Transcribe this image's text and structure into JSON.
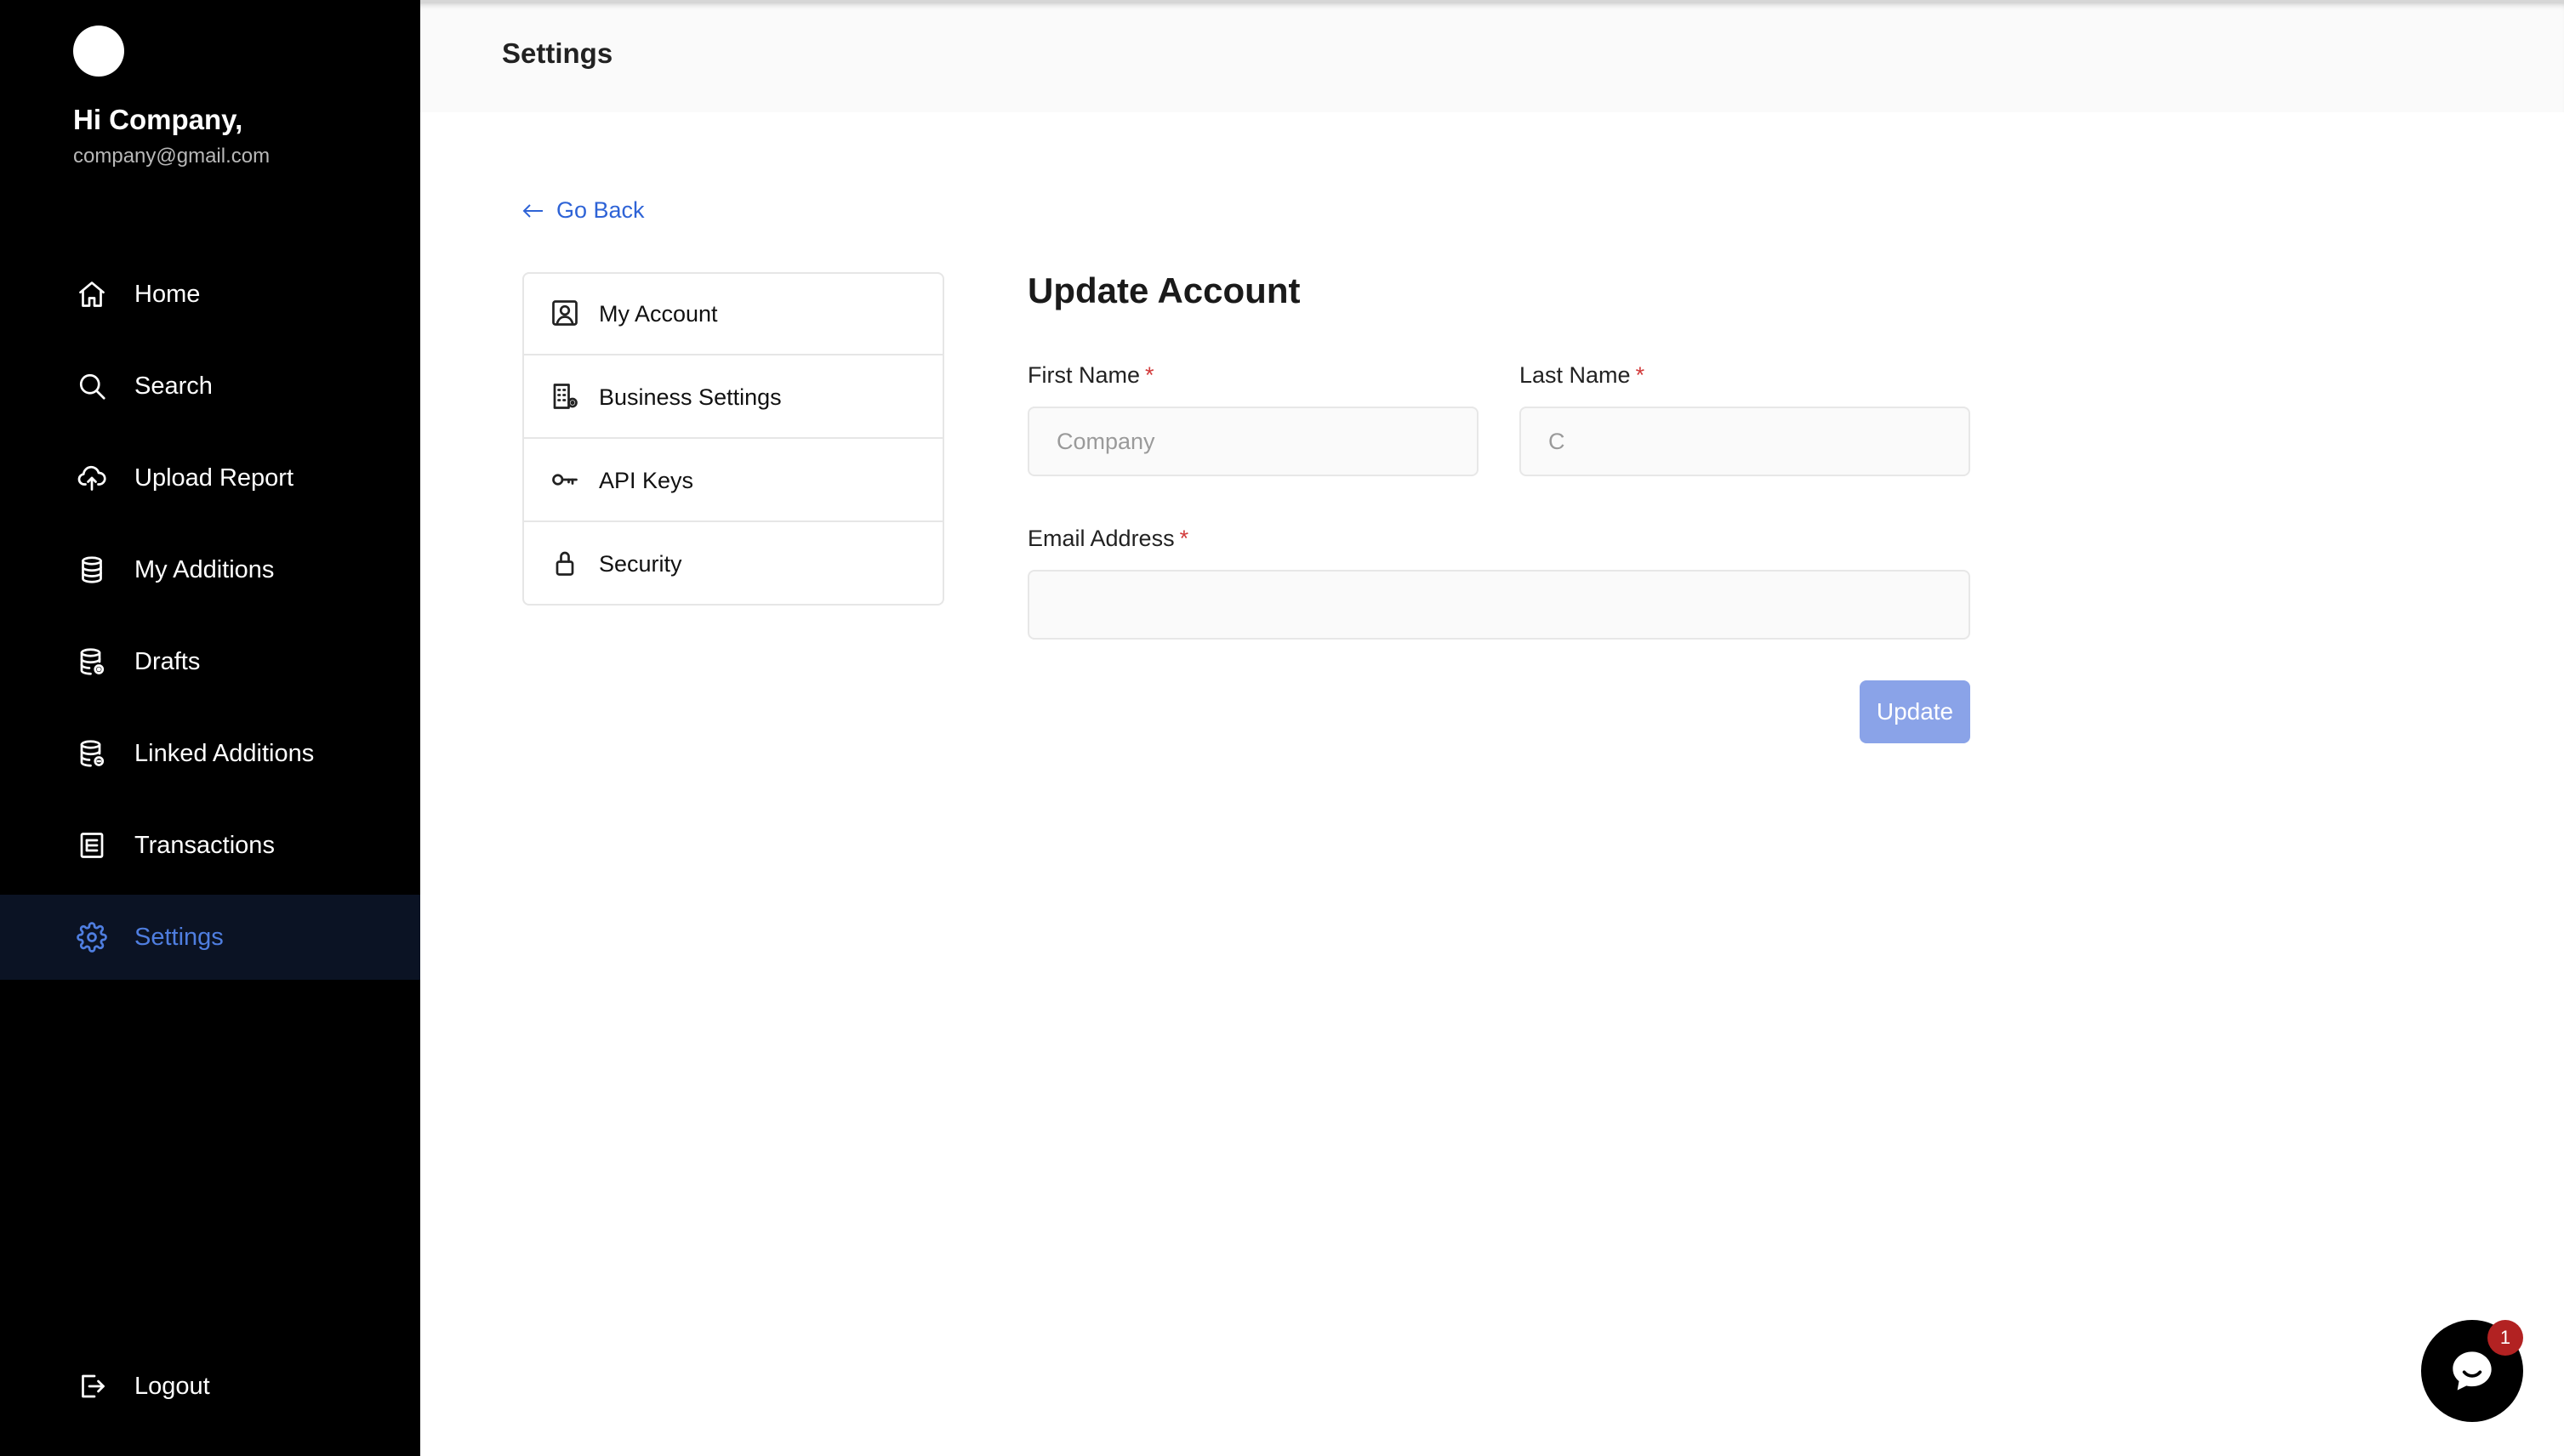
{
  "sidebar": {
    "greeting": "Hi Company,",
    "email": "company@gmail.com",
    "items": [
      {
        "label": "Home",
        "icon": "home-icon"
      },
      {
        "label": "Search",
        "icon": "search-icon"
      },
      {
        "label": "Upload Report",
        "icon": "cloud-upload-icon"
      },
      {
        "label": "My Additions",
        "icon": "database-icon"
      },
      {
        "label": "Drafts",
        "icon": "database-settings-icon"
      },
      {
        "label": "Linked Additions",
        "icon": "database-link-icon"
      },
      {
        "label": "Transactions",
        "icon": "receipt-icon"
      },
      {
        "label": "Settings",
        "icon": "gear-icon",
        "active": true
      }
    ],
    "logout": "Logout"
  },
  "header": {
    "title": "Settings"
  },
  "go_back": "Go Back",
  "settings_menu": [
    {
      "label": "My Account",
      "icon": "user-square-icon"
    },
    {
      "label": "Business Settings",
      "icon": "building-icon"
    },
    {
      "label": "API Keys",
      "icon": "key-icon"
    },
    {
      "label": "Security",
      "icon": "lock-icon"
    }
  ],
  "form": {
    "title": "Update Account",
    "first_name": {
      "label": "First Name",
      "required": "*",
      "placeholder": "Company"
    },
    "last_name": {
      "label": "Last Name",
      "required": "*",
      "placeholder": "C"
    },
    "email": {
      "label": "Email Address",
      "required": "*",
      "placeholder": ""
    },
    "submit": "Update"
  },
  "chat": {
    "badge_count": "1"
  },
  "colors": {
    "accent": "#4f7ee0",
    "link": "#2e63d6",
    "button": "#8aa3e8",
    "required": "#d23b3b",
    "sidebar_bg": "#000000"
  }
}
